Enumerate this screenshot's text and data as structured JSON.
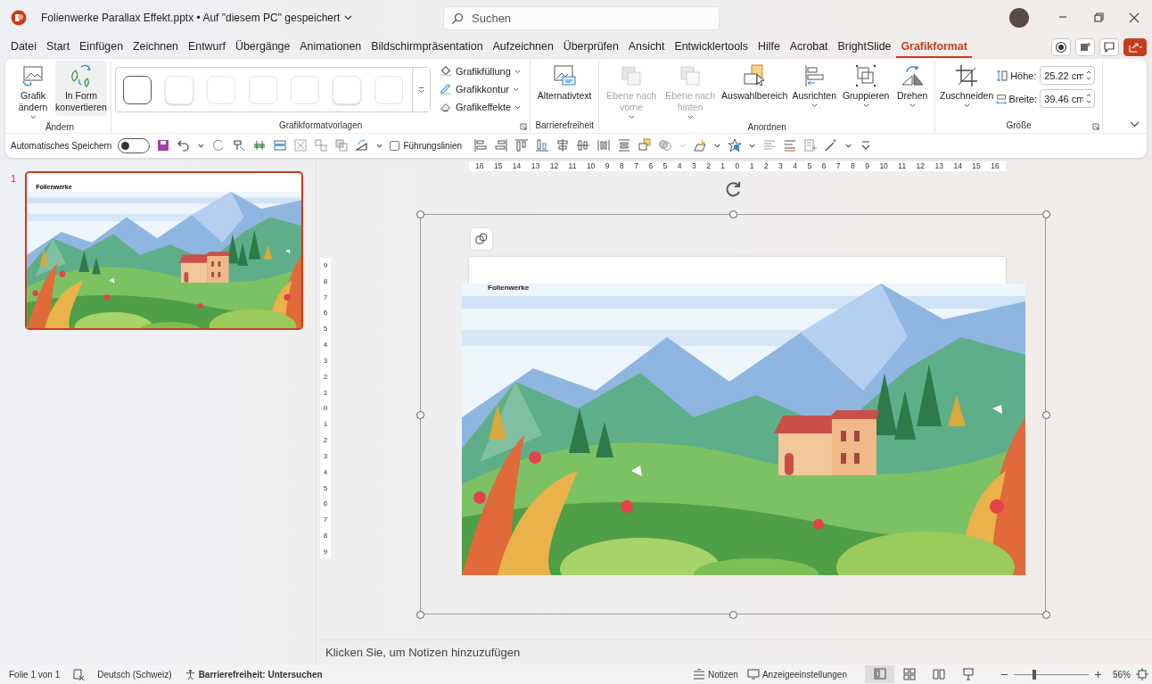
{
  "window": {
    "title": "Folienwerke Parallax Effekt.pptx • Auf \"diesem PC\" gespeichert",
    "search": {
      "placeholder": "Suchen"
    }
  },
  "menu_tabs": [
    {
      "label": "Datei",
      "selected": false
    },
    {
      "label": "Start",
      "selected": false
    },
    {
      "label": "Einfügen",
      "selected": false
    },
    {
      "label": "Zeichnen",
      "selected": false
    },
    {
      "label": "Entwurf",
      "selected": false
    },
    {
      "label": "Übergänge",
      "selected": false
    },
    {
      "label": "Animationen",
      "selected": false
    },
    {
      "label": "Bildschirmpräsentation",
      "selected": false
    },
    {
      "label": "Aufzeichnen",
      "selected": false
    },
    {
      "label": "Überprüfen",
      "selected": false
    },
    {
      "label": "Ansicht",
      "selected": false
    },
    {
      "label": "Entwicklertools",
      "selected": false
    },
    {
      "label": "Hilfe",
      "selected": false
    },
    {
      "label": "Acrobat",
      "selected": false
    },
    {
      "label": "BrightSlide",
      "selected": false
    },
    {
      "label": "Grafikformat",
      "selected": true
    }
  ],
  "ribbon": {
    "change_group": {
      "label": "Ändern",
      "buttons": [
        {
          "label": "Grafik ändern",
          "has_menu": true,
          "highlighted": false
        },
        {
          "label": "In Form konvertieren",
          "has_menu": false,
          "highlighted": true
        }
      ]
    },
    "styles_group": {
      "label": "Grafikformatvorlagen",
      "styles": [
        {
          "selected": true
        },
        {
          "selected": false
        },
        {
          "selected": false
        },
        {
          "selected": false
        },
        {
          "selected": false
        },
        {
          "selected": false
        },
        {
          "selected": false
        }
      ],
      "commands": [
        {
          "label": "Grafikfüllung"
        },
        {
          "label": "Grafikkontur"
        },
        {
          "label": "Grafikeffekte"
        }
      ]
    },
    "accessibility_group": {
      "label": "Barrierefreiheit",
      "button": {
        "label": "Alternativtext"
      }
    },
    "arrange_group": {
      "label": "Anordnen",
      "buttons": [
        {
          "label": "Ebene nach vorne",
          "disabled": true,
          "has_menu": true
        },
        {
          "label": "Ebene nach hinten",
          "disabled": true,
          "has_menu": true
        },
        {
          "label": "Auswahlbereich",
          "disabled": false,
          "has_menu": false
        },
        {
          "label": "Ausrichten",
          "disabled": false,
          "has_menu": true
        },
        {
          "label": "Gruppieren",
          "disabled": false,
          "has_menu": true
        },
        {
          "label": "Drehen",
          "disabled": false,
          "has_menu": true
        }
      ]
    },
    "size_group": {
      "label": "Größe",
      "crop": {
        "label": "Zuschneiden",
        "has_menu": true
      },
      "fields": [
        {
          "label": "Höhe:",
          "value": "25.22 cm"
        },
        {
          "label": "Breite:",
          "value": "39.46 cm"
        }
      ]
    }
  },
  "quick_access": {
    "autosave": {
      "label": "Automatisches Speichern",
      "on": false
    },
    "guides": {
      "label": "Führungslinien",
      "checked": false
    }
  },
  "rulers": {
    "horizontal": [
      "16",
      "15",
      "14",
      "13",
      "12",
      "11",
      "10",
      "9",
      "8",
      "7",
      "6",
      "5",
      "4",
      "3",
      "2",
      "1",
      "0",
      "1",
      "2",
      "3",
      "4",
      "5",
      "6",
      "7",
      "8",
      "9",
      "10",
      "11",
      "12",
      "13",
      "14",
      "15",
      "16"
    ],
    "vertical": [
      "9",
      "8",
      "7",
      "6",
      "5",
      "4",
      "3",
      "2",
      "1",
      "0",
      "1",
      "2",
      "3",
      "4",
      "5",
      "6",
      "7",
      "8",
      "9"
    ]
  },
  "thumbnails": [
    {
      "number": "1",
      "title": "Folienwerke",
      "selected": true
    }
  ],
  "slide": {
    "title": "Folienwerke"
  },
  "notes": {
    "placeholder": "Klicken Sie, um Notizen hinzuzufügen"
  },
  "status_bar": {
    "slide_info": "Folie 1 von 1",
    "language": "Deutsch (Schweiz)",
    "accessibility": "Barrierefreiheit: Untersuchen",
    "notes": "Notizen",
    "display_settings": "Anzeigeeinstellungen",
    "views": [
      {
        "selected": true
      },
      {
        "selected": false
      },
      {
        "selected": false
      },
      {
        "selected": false
      }
    ],
    "zoom": {
      "level": 0.27,
      "label": "56%"
    }
  }
}
